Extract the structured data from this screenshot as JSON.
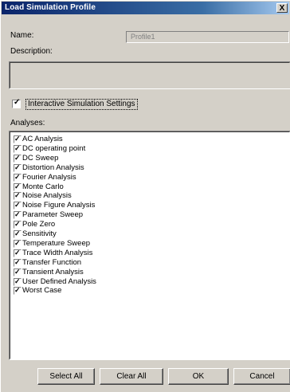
{
  "window": {
    "title": "Load Simulation Profile",
    "close_glyph": "X"
  },
  "name": {
    "label": "Name:",
    "value": "Profile1"
  },
  "description": {
    "label": "Description:",
    "value": ""
  },
  "interactive": {
    "label": "Interactive Simulation Settings",
    "checked": true
  },
  "analyses": {
    "label": "Analyses:",
    "items": [
      "AC Analysis",
      "DC operating point",
      "DC Sweep",
      "Distortion Analysis",
      "Fourier Analysis",
      "Monte Carlo",
      "Noise Analysis",
      "Noise Figure Analysis",
      "Parameter Sweep",
      "Pole Zero",
      "Sensitivity",
      "Temperature Sweep",
      "Trace Width Analysis",
      "Transfer Function",
      "Transient Analysis",
      "User Defined Analysis",
      "Worst Case"
    ]
  },
  "buttons": {
    "select_all": "Select All",
    "clear_all": "Clear All",
    "ok": "OK",
    "cancel": "Cancel"
  },
  "icons": {
    "check": "✓"
  }
}
